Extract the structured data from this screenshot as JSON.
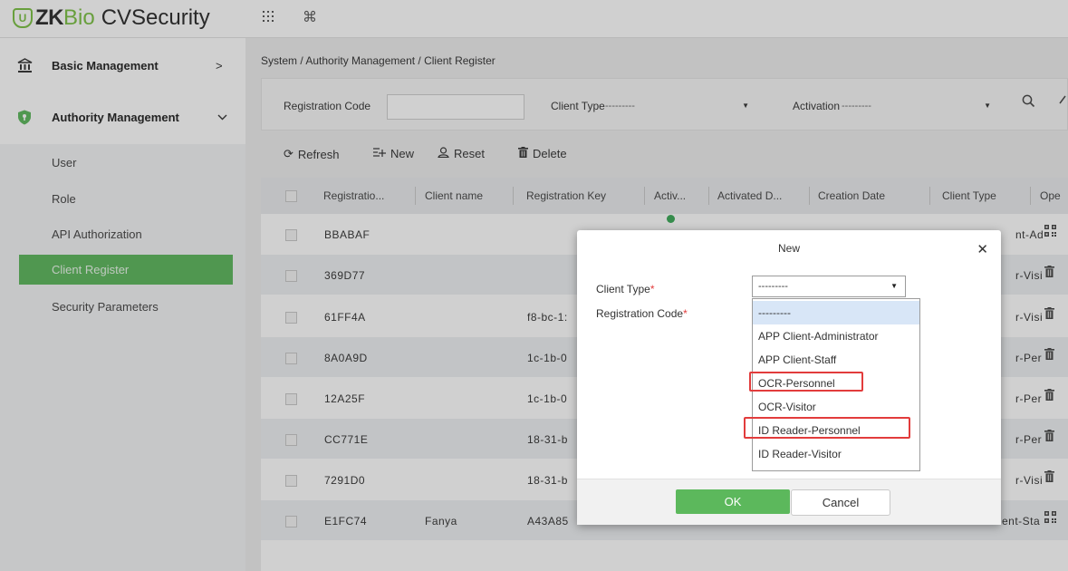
{
  "app": {
    "logo_mark": "U",
    "logo_zk": "ZK",
    "logo_bio": "Bio",
    "logo_product": "CVSecurity"
  },
  "topbar": {
    "apps_icon": "grid-icon",
    "cmd_icon": "command-icon"
  },
  "sidebar": {
    "groups": [
      {
        "label": "Basic Management",
        "caret": ">"
      },
      {
        "label": "Authority Management",
        "caret": "⌄"
      }
    ],
    "items": [
      {
        "label": "User"
      },
      {
        "label": "Role"
      },
      {
        "label": "API Authorization"
      },
      {
        "label": "Client Register",
        "active": true
      },
      {
        "label": "Security Parameters"
      }
    ]
  },
  "breadcrumb": "System / Authority Management / Client Register",
  "filters": {
    "registration_code_label": "Registration Code",
    "registration_code_value": "",
    "client_type_label": "Client Type",
    "client_type_value": "---------",
    "activation_label": "Activation",
    "activation_value": "---------"
  },
  "toolbar": {
    "refresh": "Refresh",
    "new": "New",
    "reset": "Reset",
    "delete": "Delete"
  },
  "table": {
    "headers": [
      "Registratio...",
      "Client name",
      "Registration Key",
      "Activ...",
      "Activated D...",
      "Creation Date",
      "Client Type",
      "Ope"
    ],
    "rows": [
      {
        "code": "BBABAF",
        "name": "",
        "key": "",
        "client_type": "nt-Ad",
        "op_icon": "qr-code-icon"
      },
      {
        "code": "369D77",
        "name": "",
        "key": "",
        "client_type": "r-Visi",
        "op_icon": "trash-icon"
      },
      {
        "code": "61FF4A",
        "name": "",
        "key": "f8-bc-1:",
        "client_type": "r-Visi",
        "op_icon": "trash-icon"
      },
      {
        "code": "8A0A9D",
        "name": "",
        "key": "1c-1b-0",
        "client_type": "r-Per",
        "op_icon": "trash-icon"
      },
      {
        "code": "12A25F",
        "name": "",
        "key": "1c-1b-0",
        "client_type": "r-Per",
        "op_icon": "trash-icon"
      },
      {
        "code": "CC771E",
        "name": "",
        "key": "18-31-b",
        "client_type": "r-Per",
        "op_icon": "trash-icon"
      },
      {
        "code": "7291D0",
        "name": "",
        "key": "18-31-b",
        "client_type": "r-Visi",
        "op_icon": "trash-icon"
      },
      {
        "code": "E1FC74",
        "name": "Fanya",
        "key": "A43A85",
        "client_type": "ent-Sta",
        "op_icon": "qr-code-icon"
      }
    ]
  },
  "modal": {
    "title": "New",
    "client_type_label": "Client Type",
    "registration_code_label": "Registration Code",
    "required_mark": "*",
    "client_type_value": "---------",
    "options": [
      "---------",
      "APP Client-Administrator",
      "APP Client-Staff",
      "OCR-Personnel",
      "OCR-Visitor",
      "ID Reader-Personnel",
      "ID Reader-Visitor"
    ],
    "highlighted_options": [
      "OCR-Personnel",
      "ID Reader-Personnel"
    ],
    "ok_label": "OK",
    "cancel_label": "Cancel"
  },
  "colors": {
    "accent_green": "#5cb85c",
    "highlight_red": "#e23c3c",
    "selected_option": "#d8e6f7"
  }
}
